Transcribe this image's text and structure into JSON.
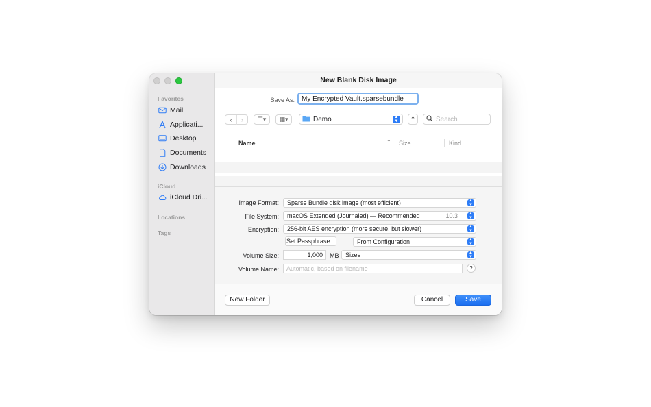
{
  "window": {
    "title": "New Blank Disk Image"
  },
  "sidebar": {
    "sections": {
      "favorites": "Favorites",
      "icloud": "iCloud",
      "locations": "Locations",
      "tags": "Tags"
    },
    "favorites": [
      {
        "label": "Mail",
        "icon": "mail-icon"
      },
      {
        "label": "Applicati...",
        "icon": "applications-icon"
      },
      {
        "label": "Desktop",
        "icon": "desktop-icon"
      },
      {
        "label": "Documents",
        "icon": "document-icon"
      },
      {
        "label": "Downloads",
        "icon": "downloads-icon"
      }
    ],
    "icloud": [
      {
        "label": "iCloud Dri...",
        "icon": "cloud-icon"
      }
    ]
  },
  "save": {
    "label": "Save As:",
    "value": "My Encrypted Vault.sparsebundle"
  },
  "toolbar": {
    "location": "Demo",
    "search_placeholder": "Search"
  },
  "list": {
    "columns": {
      "name": "Name",
      "size": "Size",
      "kind": "Kind"
    },
    "rows": []
  },
  "options": {
    "image_format": {
      "label": "Image Format:",
      "value": "Sparse Bundle disk image (most efficient)"
    },
    "file_system": {
      "label": "File System:",
      "value": "macOS Extended (Journaled) — Recommended",
      "version": "10.3"
    },
    "encryption": {
      "label": "Encryption:",
      "value": "256-bit AES encryption (more secure, but slower)"
    },
    "set_passphrase": "Set Passphrase...",
    "passphrase_source": "From Configuration",
    "volume_size": {
      "label": "Volume Size:",
      "value": "1,000",
      "unit": "MB",
      "preset": "Sizes"
    },
    "volume_name": {
      "label": "Volume Name:",
      "placeholder": "Automatic, based on filename"
    },
    "help": "?"
  },
  "footer": {
    "new_folder": "New Folder",
    "cancel": "Cancel",
    "save": "Save"
  },
  "colors": {
    "accent": "#2e7df7",
    "sidebar_bg": "#e9e8e9",
    "sidebar_icon": "#2f7cf6",
    "traffic_green": "#2bc840"
  }
}
